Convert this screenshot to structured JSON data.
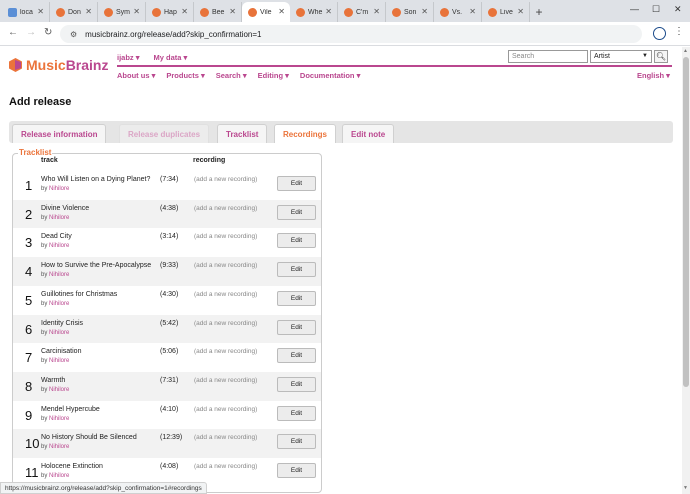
{
  "browser": {
    "tabs": [
      {
        "label": "loca",
        "icon": "music-note-icon"
      },
      {
        "label": "Don",
        "icon": "musicbrainz-icon"
      },
      {
        "label": "Sym",
        "icon": "musicbrainz-icon"
      },
      {
        "label": "Hap",
        "icon": "musicbrainz-icon"
      },
      {
        "label": "Bee",
        "icon": "musicbrainz-icon"
      },
      {
        "label": "Vile",
        "icon": "musicbrainz-icon",
        "active": true
      },
      {
        "label": "Whe",
        "icon": "musicbrainz-icon"
      },
      {
        "label": "C'm",
        "icon": "musicbrainz-icon"
      },
      {
        "label": "Son",
        "icon": "musicbrainz-icon"
      },
      {
        "label": "Vs.",
        "icon": "musicbrainz-icon"
      },
      {
        "label": "Live",
        "icon": "musicbrainz-icon"
      }
    ],
    "new_tab": "+",
    "url": "musicbrainz.org/release/add?skip_confirmation=1",
    "status_url": "https://musicbrainz.org/release/add?skip_confirmation=1#recordings"
  },
  "site": {
    "logo_music": "Music",
    "logo_brainz": "Brainz",
    "user": "ijabz",
    "my_data": "My data",
    "search_placeholder": "Search",
    "search_type": "Artist",
    "menu": [
      "About us",
      "Products",
      "Search",
      "Editing",
      "Documentation"
    ],
    "language": "English"
  },
  "page": {
    "title": "Add release",
    "tabs": [
      {
        "label": "Release information",
        "state": "normal"
      },
      {
        "label": "Release duplicates",
        "state": "disabled"
      },
      {
        "label": "Tracklist",
        "state": "normal"
      },
      {
        "label": "Recordings",
        "state": "active"
      },
      {
        "label": "Edit note",
        "state": "normal"
      }
    ],
    "tracklist_legend": "Tracklist",
    "col_track": "track",
    "col_recording": "recording",
    "tracks": [
      {
        "num": "1",
        "title": "Who Will Listen on a Dying Planet?",
        "by": "by",
        "artist": "Nihilore",
        "length": "(7:34)",
        "recording": "(add a new recording)",
        "edit": "Edit"
      },
      {
        "num": "2",
        "title": "Divine Violence",
        "by": "by",
        "artist": "Nihilore",
        "length": "(4:38)",
        "recording": "(add a new recording)",
        "edit": "Edit"
      },
      {
        "num": "3",
        "title": "Dead City",
        "by": "by",
        "artist": "Nihilore",
        "length": "(3:14)",
        "recording": "(add a new recording)",
        "edit": "Edit"
      },
      {
        "num": "4",
        "title": "How to Survive the Pre-Apocalypse",
        "by": "by",
        "artist": "Nihilore",
        "length": "(9:33)",
        "recording": "(add a new recording)",
        "edit": "Edit"
      },
      {
        "num": "5",
        "title": "Guillotines for Christmas",
        "by": "by",
        "artist": "Nihilore",
        "length": "(4:30)",
        "recording": "(add a new recording)",
        "edit": "Edit"
      },
      {
        "num": "6",
        "title": "Identity Crisis",
        "by": "by",
        "artist": "Nihilore",
        "length": "(5:42)",
        "recording": "(add a new recording)",
        "edit": "Edit"
      },
      {
        "num": "7",
        "title": "Carcinisation",
        "by": "by",
        "artist": "Nihilore",
        "length": "(5:06)",
        "recording": "(add a new recording)",
        "edit": "Edit"
      },
      {
        "num": "8",
        "title": "Warmth",
        "by": "by",
        "artist": "Nihilore",
        "length": "(7:31)",
        "recording": "(add a new recording)",
        "edit": "Edit"
      },
      {
        "num": "9",
        "title": "Mendel Hypercube",
        "by": "by",
        "artist": "Nihilore",
        "length": "(4:10)",
        "recording": "(add a new recording)",
        "edit": "Edit"
      },
      {
        "num": "10",
        "title": "No History Should Be Silenced",
        "by": "by",
        "artist": "Nihilore",
        "length": "(12:39)",
        "recording": "(add a new recording)",
        "edit": "Edit"
      },
      {
        "num": "11",
        "title": "Holocene Extinction",
        "by": "by",
        "artist": "Nihilore",
        "length": "(4:08)",
        "recording": "(add a new recording)",
        "edit": "Edit"
      }
    ]
  },
  "colors": {
    "brand_orange": "#eb743b",
    "brand_purple": "#ba478f"
  }
}
